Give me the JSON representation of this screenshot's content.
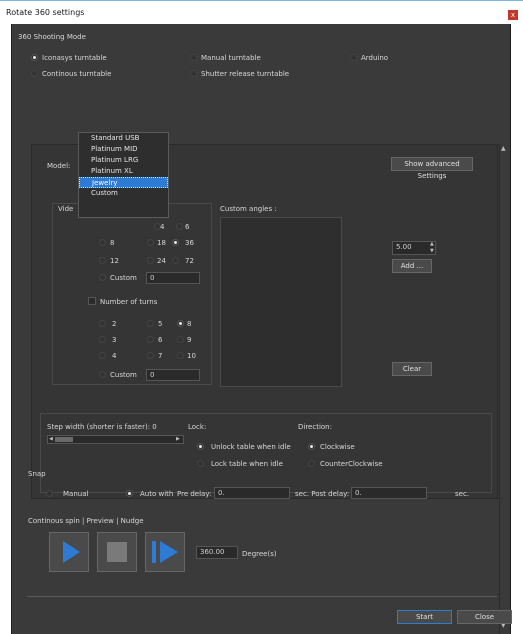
{
  "window": {
    "title": "Rotate 360 settings",
    "close_glyph": "x"
  },
  "shooting_mode": {
    "label": "360 Shooting Mode",
    "options": [
      {
        "label": "Iconasys turntable",
        "selected": true
      },
      {
        "label": "Manual turntable",
        "selected": false
      },
      {
        "label": "Arduino",
        "selected": false
      },
      {
        "label": "Continous turntable",
        "selected": false
      },
      {
        "label": "Shutter release turntable",
        "selected": false
      }
    ]
  },
  "model": {
    "label": "Model:",
    "options": [
      "Standard USB",
      "Platinum MID",
      "Platinum LRG",
      "Platinum XL",
      "Jewelry",
      "Custom"
    ],
    "highlighted": "Jewelry"
  },
  "advanced_button": "Show advanced Settings",
  "video_partial": "Vide",
  "frames_partial": ":",
  "custom_angles_label": "Custom angles :",
  "frames": {
    "options": [
      "4",
      "6",
      "8",
      "18",
      "36",
      "12",
      "24",
      "72"
    ],
    "selected": "36",
    "custom_label": "Custom",
    "custom_value": "0"
  },
  "angle_value": "5.00",
  "add_button": "Add ...",
  "clear_button": "Clear",
  "turns": {
    "label": "Number of turns",
    "options": [
      "2",
      "5",
      "8",
      "3",
      "6",
      "9",
      "4",
      "7",
      "10"
    ],
    "selected": "8",
    "custom_label": "Custom",
    "custom_value": "0"
  },
  "step": {
    "label": "Step width (shorter is faster): 0"
  },
  "lock": {
    "label": "Lock:",
    "options": [
      {
        "label": "Unlock table when idle",
        "selected": true
      },
      {
        "label": "Lock table when idle",
        "selected": false
      }
    ]
  },
  "direction": {
    "label": "Direction:",
    "options": [
      {
        "label": "Clockwise",
        "selected": true
      },
      {
        "label": "CounterClockwise",
        "selected": false
      }
    ]
  },
  "snap": {
    "label": "Snap",
    "manual": "Manual",
    "auto": "Auto with",
    "auto_selected": true,
    "pre_delay_label": "Pre delay:",
    "pre_delay": "0.",
    "post_delay_label": "sec. Post delay:",
    "post_delay": "0.",
    "sec_label": "sec."
  },
  "continuous": {
    "label": "Continous spin | Preview | Nudge",
    "degrees": "360.00",
    "degrees_label": "Degree(s)"
  },
  "footer": {
    "start": "Start",
    "close": "Close"
  },
  "colors": {
    "accent": "#2e7bd6",
    "background": "#3a3a3a"
  }
}
